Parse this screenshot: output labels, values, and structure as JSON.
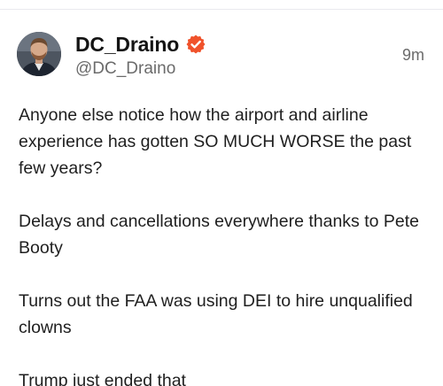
{
  "post": {
    "author": {
      "display_name": "DC_Draino",
      "handle": "@DC_Draino",
      "verified": true,
      "badge_color": "#f0522b",
      "avatar_icon": "profile-photo-icon"
    },
    "timestamp": "9m",
    "paragraphs": [
      "Anyone else notice how the airport and airline experience has gotten SO MUCH WORSE the past few years?",
      "Delays and cancellations everywhere thanks to Pete Booty",
      "Turns out the FAA was using DEI to hire unqualified clowns",
      "Trump just ended that"
    ]
  }
}
